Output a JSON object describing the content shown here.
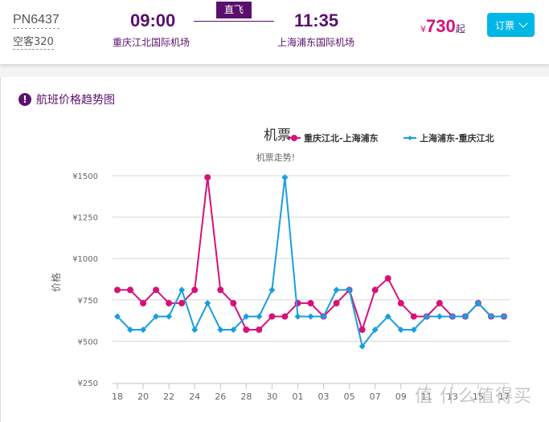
{
  "flight": {
    "flight_no": "PN6437",
    "aircraft": "空客320",
    "departure": {
      "time": "09:00",
      "airport": "重庆江北国际机场"
    },
    "arrival": {
      "time": "11:35",
      "airport": "上海浦东国际机场"
    },
    "badge": "直飞",
    "price": {
      "currency": "¥",
      "amount": "730",
      "suffix": "起"
    },
    "book_button": "订票"
  },
  "panel": {
    "title": "航班价格趋势图",
    "icon": "info-icon"
  },
  "watermark": "值 什么值得买",
  "colors": {
    "brand": "#5a0f6e",
    "pink": "#d6117a",
    "blue": "#1a9ee0",
    "button": "#00b7e8"
  },
  "chart_data": {
    "type": "line",
    "title": "机票",
    "subtitle": "机票走势!",
    "xlabel": "",
    "ylabel": "价格",
    "ylim": [
      250,
      1500
    ],
    "yticks": [
      250,
      500,
      750,
      1000,
      1250,
      1500
    ],
    "ytick_labels": [
      "¥250",
      "¥500",
      "¥750",
      "¥1000",
      "¥1250",
      "¥1500"
    ],
    "grid": true,
    "legend_position": "top-right",
    "x": [
      "18",
      "19",
      "20",
      "21",
      "22",
      "23",
      "24",
      "25",
      "26",
      "27",
      "28",
      "29",
      "30",
      "31",
      "01",
      "02",
      "03",
      "04",
      "05",
      "06",
      "07",
      "08",
      "09",
      "10",
      "11",
      "12",
      "13",
      "14",
      "15",
      "16",
      "17"
    ],
    "xtick_labels": [
      "18",
      "20",
      "22",
      "24",
      "26",
      "28",
      "30",
      "01",
      "03",
      "05",
      "07",
      "09",
      "11",
      "13",
      "15",
      "17"
    ],
    "series": [
      {
        "name": "重庆江北-上海浦东",
        "color": "#d6117a",
        "marker": "circle",
        "values": [
          810,
          810,
          730,
          810,
          730,
          730,
          810,
          1490,
          810,
          730,
          570,
          570,
          650,
          650,
          730,
          730,
          650,
          730,
          810,
          570,
          810,
          880,
          730,
          650,
          650,
          730,
          650,
          650,
          730,
          650,
          650
        ]
      },
      {
        "name": "上海浦东-重庆江北",
        "color": "#1a9ee0",
        "marker": "diamond",
        "values": [
          650,
          570,
          570,
          650,
          650,
          810,
          570,
          730,
          570,
          570,
          650,
          650,
          810,
          1490,
          650,
          650,
          650,
          810,
          810,
          470,
          570,
          650,
          570,
          570,
          650,
          650,
          650,
          650,
          730,
          650,
          650
        ]
      }
    ]
  }
}
